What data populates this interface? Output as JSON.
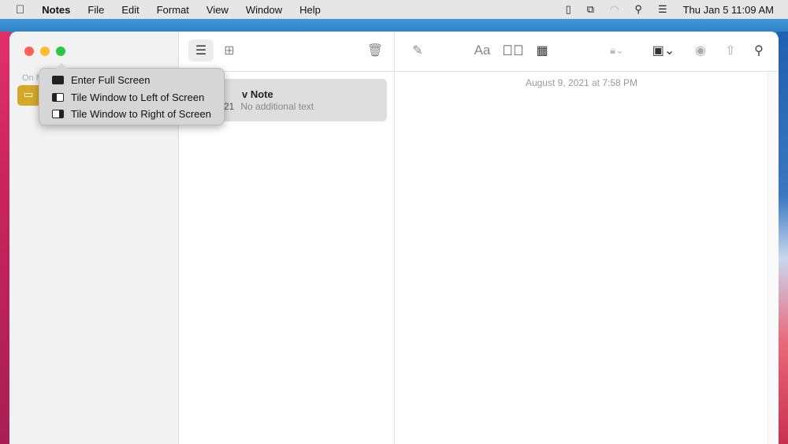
{
  "menubar": {
    "app": "Notes",
    "items": [
      "File",
      "Edit",
      "Format",
      "View",
      "Window",
      "Help"
    ],
    "clock": "Thu Jan 5  11:09 AM"
  },
  "sidebar": {
    "section": "On M",
    "folder_icon": "folder-icon"
  },
  "note": {
    "title": "v Note",
    "date_fragment": "21",
    "preview": "No additional text"
  },
  "editor": {
    "date": "August 9, 2021 at 7:58 PM"
  },
  "popup": {
    "items": [
      "Enter Full Screen",
      "Tile Window to Left of Screen",
      "Tile Window to Right of Screen"
    ]
  },
  "toolbar": {
    "format_label": "Aa"
  },
  "colors": {
    "close": "#fe5f57",
    "minimize": "#febc2e",
    "zoom": "#28c840",
    "folder": "#d4a82a"
  }
}
